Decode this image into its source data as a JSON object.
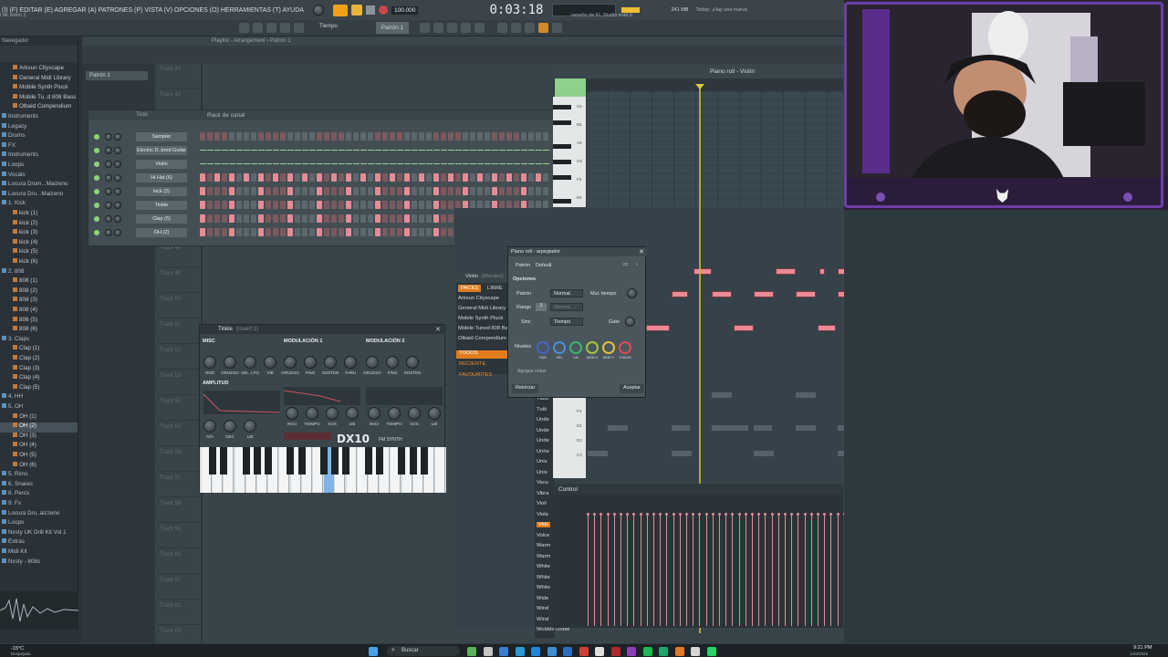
{
  "menu": {
    "items": "(I) (F) EDITAR (E) AGREGAR (A) PATRONES (P) VISTA (V) OPCIONES (O) HERRAMIENTAS (T) AYUDA",
    "hint": "l de zoom 1",
    "tempo": "100.000",
    "time": "0:03:18",
    "memory": "241 MB",
    "news_title": "Today: ¡Hay una nueva",
    "news_body": "versión de FL Studio está d",
    "pattern_label": "Patrón 1",
    "tempo_label": "Tiempo",
    "small_counter": "2"
  },
  "browser": {
    "title": "Navegador",
    "items": [
      {
        "label": "Arksun Cityscape",
        "type": "item"
      },
      {
        "label": "General Midi Library",
        "type": "item"
      },
      {
        "label": "Mobile Synth Pluck",
        "type": "item"
      },
      {
        "label": "Mobile Tu..d 808 Bass",
        "type": "item"
      },
      {
        "label": "Olbaid Compendium",
        "type": "item"
      },
      {
        "label": "Instruments",
        "type": "folder"
      },
      {
        "label": "Legacy",
        "type": "folder"
      },
      {
        "label": "Drums",
        "type": "folder"
      },
      {
        "label": "FX",
        "type": "folder"
      },
      {
        "label": "Instruments",
        "type": "folder"
      },
      {
        "label": "Loops",
        "type": "folder"
      },
      {
        "label": "Vocals",
        "type": "folder"
      },
      {
        "label": "Locura Drum...Maizeno",
        "type": "folder"
      },
      {
        "label": "Locura Dru...Maizeno",
        "type": "folder"
      },
      {
        "label": "1. Kick",
        "type": "folder"
      },
      {
        "label": "kick (1)",
        "type": "item"
      },
      {
        "label": "kick (2)",
        "type": "item"
      },
      {
        "label": "kick (3)",
        "type": "item"
      },
      {
        "label": "kick (4)",
        "type": "item"
      },
      {
        "label": "kick (5)",
        "type": "item"
      },
      {
        "label": "kick (6)",
        "type": "item"
      },
      {
        "label": "2. 808",
        "type": "folder"
      },
      {
        "label": "808 (1)",
        "type": "item"
      },
      {
        "label": "808 (2)",
        "type": "item"
      },
      {
        "label": "808 (3)",
        "type": "item"
      },
      {
        "label": "808 (4)",
        "type": "item"
      },
      {
        "label": "808 (5)",
        "type": "item"
      },
      {
        "label": "808 (6)",
        "type": "item"
      },
      {
        "label": "3. Claps",
        "type": "folder"
      },
      {
        "label": "Clap (1)",
        "type": "item"
      },
      {
        "label": "Clap (2)",
        "type": "item"
      },
      {
        "label": "Clap (3)",
        "type": "item"
      },
      {
        "label": "Clap (4)",
        "type": "item"
      },
      {
        "label": "Clap (5)",
        "type": "item"
      },
      {
        "label": "4. HH",
        "type": "folder"
      },
      {
        "label": "5. OH",
        "type": "folder"
      },
      {
        "label": "OH (1)",
        "type": "item"
      },
      {
        "label": "OH (2)",
        "type": "selected"
      },
      {
        "label": "OH (3)",
        "type": "item"
      },
      {
        "label": "OH (4)",
        "type": "item"
      },
      {
        "label": "OH (5)",
        "type": "item"
      },
      {
        "label": "OH (6)",
        "type": "item"
      },
      {
        "label": "5. Rims",
        "type": "folder"
      },
      {
        "label": "6. Snares",
        "type": "folder"
      },
      {
        "label": "8. Percs",
        "type": "folder"
      },
      {
        "label": "9. Fx",
        "type": "folder"
      },
      {
        "label": "Locura Dru..aizzeno",
        "type": "folder"
      },
      {
        "label": "Loops",
        "type": "folder"
      },
      {
        "label": "Nxsty UK Drill Kit Vol.1",
        "type": "folder"
      },
      {
        "label": "Extras",
        "type": "folder"
      },
      {
        "label": "Midi Kit",
        "type": "folder"
      },
      {
        "label": "Nxsty - 808s",
        "type": "folder"
      }
    ]
  },
  "playlist": {
    "title": "Playlist - Arrangement › Patrón 1",
    "pattern": "Patrón 1",
    "tracks": [
      "Track 41",
      "Track 42",
      "Track 43",
      "Track 44",
      "Track 45",
      "Track 46",
      "Track 47",
      "Track 48",
      "Track 49",
      "Track 50",
      "Track 51",
      "Track 52",
      "Track 53",
      "Track 54",
      "Track 55",
      "Track 56",
      "Track 57",
      "Track 58",
      "Track 59",
      "Track 60",
      "Track 61",
      "Track 62",
      "Track 63"
    ]
  },
  "rack": {
    "title": "Rack de canal",
    "filter": "Todo",
    "channels": [
      "Sampler",
      "Electric D..bred Guitar",
      "Violin",
      "Hi Hat (6)",
      "kick (2)",
      "Tinkle",
      "Clap (5)",
      "OH (2)"
    ]
  },
  "dx10": {
    "title": "Tinkle",
    "title_sub": "(Insert 1)",
    "sections": [
      "MISC",
      "MODULACIÓN 1",
      "MODULACIÓN 2",
      "AMPLITUD"
    ],
    "misc_knobs": [
      "RND",
      "GRUESO",
      "VEL. LFO",
      "VIB"
    ],
    "mod1_knobs": [
      "GRUESO",
      "FINO",
      "SOSTEN",
      "THRU"
    ],
    "mod2_knobs": [
      "GRUESO",
      "FINO",
      "SOSTEN"
    ],
    "amp_knobs": [
      "ATA",
      "DEC",
      "LIB"
    ],
    "env_knobs": [
      "INICI",
      "TIEMPO",
      "SOS",
      "LIB",
      "INICI",
      "TIEMPO",
      "SOS",
      "LIB"
    ],
    "logo": "DX10",
    "logo_sub": "FM SYNTH"
  },
  "pianoroll": {
    "title": "Piano roll - Violín",
    "keys": [
      "C6",
      "B5",
      "A5",
      "G5",
      "F5",
      "E5"
    ],
    "low_keys": [
      "F3",
      "E3",
      "D3",
      "C3"
    ],
    "control_label": "Control"
  },
  "arpeggiator": {
    "title": "Piano roll - arpegiador",
    "preset_label": "Patrón",
    "preset": "Default",
    "options_label": "Opciones",
    "patron_label": "Patrón",
    "patron_value": "Normal",
    "mul_label": "Mul. tiempo",
    "rango_label": "Rango",
    "rango_value": "1",
    "rango_mode": "Normal",
    "sinc_label": "Sinc",
    "sinc_value": "Tiempo",
    "gate_label": "Gate",
    "niveles_label": "Niveles",
    "level_labels": [
      "PAN",
      "VEL",
      "LM",
      "MOD X",
      "MOD Y",
      "TODOS"
    ],
    "agrupar": "Agrupar notas",
    "reiniciar": "Reiniciar",
    "aceptar": "Aceptar"
  },
  "packs": {
    "tabs": [
      "PACKS",
      "LIBRE"
    ],
    "header": "Violin",
    "header_sub": "(Morden)",
    "items": [
      "Arksun Cityscape",
      "General Midi Library",
      "Mobile Synth Pluck",
      "Mobile Tuned 808 Bass",
      "Olbaid Compendium"
    ],
    "filters": [
      "TODOS",
      "RECIENTE",
      "FAVOURITES"
    ]
  },
  "instruments": [
    "Tubu",
    "Tutti",
    "Unde",
    "Unde",
    "Unde",
    "Unhe",
    "Unis",
    "Unis",
    "Vacu",
    "Vibra",
    "Violi",
    "Viola",
    "Violi",
    "Voice",
    "Warm",
    "Warm",
    "White",
    "White",
    "White",
    "Wide",
    "Wind",
    "Wind",
    "Wobble Doble"
  ],
  "taskbar": {
    "weather": "-15°C",
    "weather_sub": "Despejado",
    "search": "Buscar",
    "clock": "9:21 PM",
    "date": "1/18/2025"
  },
  "colors": {
    "accent": "#f0a11a",
    "note": "#e98a94",
    "playhead": "#d8c23a",
    "frame": "#6b3fa6"
  }
}
